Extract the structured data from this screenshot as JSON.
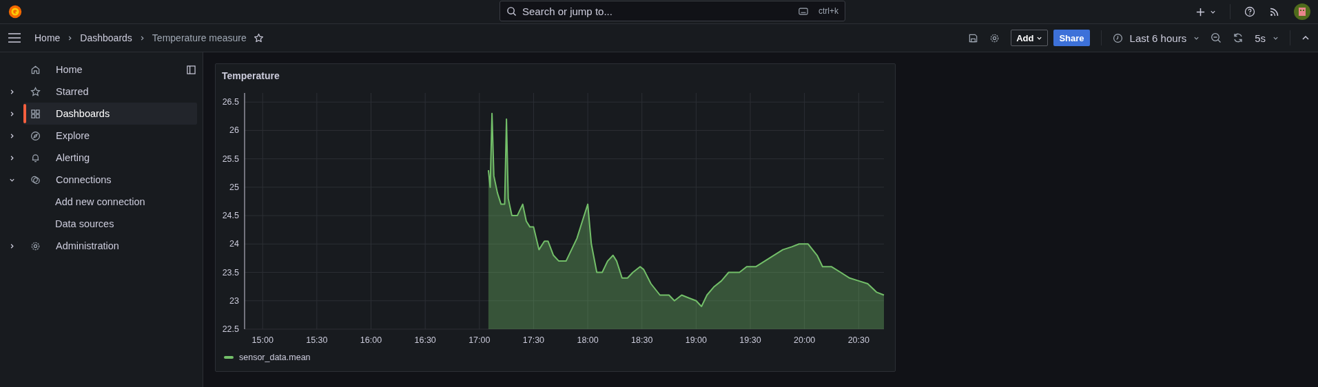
{
  "topbar": {
    "search": {
      "placeholder": "Search or jump to...",
      "shortcut": "ctrl+k"
    }
  },
  "breadcrumbs": [
    {
      "label": "Home",
      "current": false
    },
    {
      "label": "Dashboards",
      "current": false
    },
    {
      "label": "Temperature measure",
      "current": true
    }
  ],
  "toolbar": {
    "add_button": "Add",
    "share_button": "Share",
    "time_range": "Last 6 hours",
    "refresh_interval": "5s"
  },
  "sidebar": {
    "items": [
      {
        "label": "Home",
        "kind": "leaf",
        "selected": false
      },
      {
        "label": "Starred",
        "kind": "group",
        "selected": false,
        "expanded": false
      },
      {
        "label": "Dashboards",
        "kind": "group",
        "selected": true,
        "expanded": false
      },
      {
        "label": "Explore",
        "kind": "group",
        "selected": false,
        "expanded": false
      },
      {
        "label": "Alerting",
        "kind": "group",
        "selected": false,
        "expanded": false
      },
      {
        "label": "Connections",
        "kind": "group",
        "selected": false,
        "expanded": true,
        "children": [
          {
            "label": "Add new connection",
            "selected": false
          },
          {
            "label": "Data sources",
            "selected": false
          }
        ]
      },
      {
        "label": "Administration",
        "kind": "group",
        "selected": false,
        "expanded": false
      }
    ]
  },
  "panel": {
    "title": "Temperature",
    "chart_data": {
      "type": "area",
      "grid": true,
      "xlim": [
        890,
        1244
      ],
      "ylim": [
        22.5,
        26.66
      ],
      "xticks": [
        {
          "value": 900,
          "label": "15:00"
        },
        {
          "value": 930,
          "label": "15:30"
        },
        {
          "value": 960,
          "label": "16:00"
        },
        {
          "value": 990,
          "label": "16:30"
        },
        {
          "value": 1020,
          "label": "17:00"
        },
        {
          "value": 1050,
          "label": "17:30"
        },
        {
          "value": 1080,
          "label": "18:00"
        },
        {
          "value": 1110,
          "label": "18:30"
        },
        {
          "value": 1140,
          "label": "19:00"
        },
        {
          "value": 1170,
          "label": "19:30"
        },
        {
          "value": 1200,
          "label": "20:00"
        },
        {
          "value": 1230,
          "label": "20:30"
        }
      ],
      "yticks": [
        {
          "value": 22.5,
          "label": "22.5"
        },
        {
          "value": 23,
          "label": "23"
        },
        {
          "value": 23.5,
          "label": "23.5"
        },
        {
          "value": 24,
          "label": "24"
        },
        {
          "value": 24.5,
          "label": "24.5"
        },
        {
          "value": 25,
          "label": "25"
        },
        {
          "value": 25.5,
          "label": "25.5"
        },
        {
          "value": 26,
          "label": "26"
        },
        {
          "value": 26.5,
          "label": "26.5"
        }
      ],
      "x": [
        1025,
        1026,
        1027,
        1028,
        1030,
        1032,
        1034,
        1035,
        1036,
        1038,
        1041,
        1044,
        1046,
        1048,
        1050,
        1053,
        1056,
        1058,
        1061,
        1064,
        1068,
        1071,
        1074,
        1077,
        1080,
        1082,
        1085,
        1088,
        1091,
        1094,
        1096,
        1099,
        1102,
        1105,
        1109,
        1111,
        1115,
        1120,
        1125,
        1128,
        1132,
        1136,
        1140,
        1143,
        1146,
        1150,
        1154,
        1158,
        1164,
        1168,
        1173,
        1178,
        1183,
        1188,
        1193,
        1197,
        1202,
        1207,
        1210,
        1215,
        1220,
        1225,
        1230,
        1235,
        1240,
        1244
      ],
      "series": [
        {
          "name": "sensor_data.mean",
          "color": "#73bf69",
          "values": [
            25.3,
            25.0,
            26.3,
            25.2,
            24.9,
            24.7,
            24.7,
            26.2,
            24.8,
            24.5,
            24.5,
            24.7,
            24.4,
            24.3,
            24.3,
            23.9,
            24.05,
            24.05,
            23.8,
            23.7,
            23.7,
            23.9,
            24.1,
            24.4,
            24.7,
            24.0,
            23.5,
            23.5,
            23.7,
            23.8,
            23.7,
            23.4,
            23.4,
            23.5,
            23.6,
            23.55,
            23.3,
            23.1,
            23.1,
            23.0,
            23.1,
            23.05,
            23.0,
            22.9,
            23.1,
            23.25,
            23.35,
            23.5,
            23.5,
            23.6,
            23.6,
            23.7,
            23.8,
            23.9,
            23.95,
            24.0,
            24.0,
            23.8,
            23.6,
            23.6,
            23.5,
            23.4,
            23.35,
            23.3,
            23.15,
            23.1
          ]
        }
      ]
    }
  }
}
